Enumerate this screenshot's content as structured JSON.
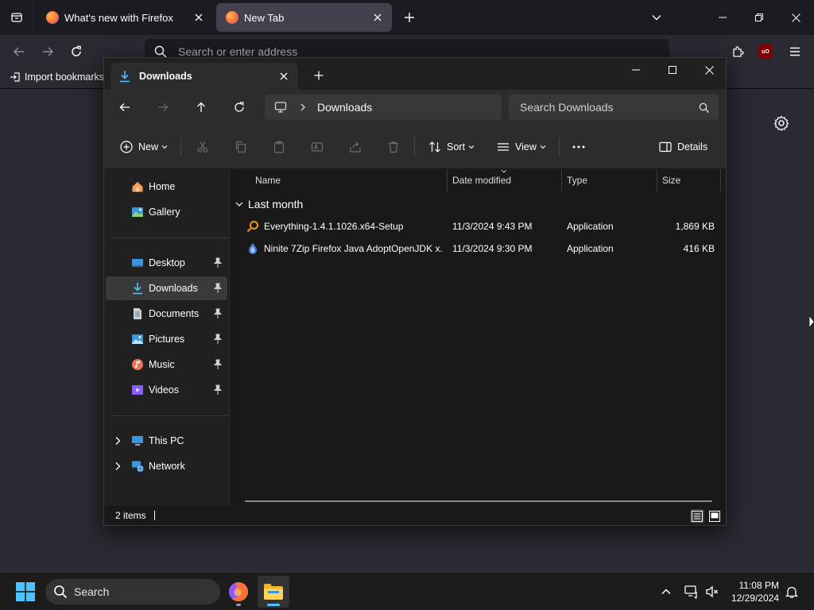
{
  "firefox": {
    "tabs": [
      {
        "title": "What's new with Firefox",
        "active": false
      },
      {
        "title": "New Tab",
        "active": true
      }
    ],
    "urlbar_placeholder": "Search or enter address",
    "bookmarks": {
      "import_label": "Import bookmarks..."
    },
    "extension_badge": "uO"
  },
  "explorer": {
    "tab_title": "Downloads",
    "breadcrumb": [
      "Downloads"
    ],
    "search_placeholder": "Search Downloads",
    "commands": {
      "new": "New",
      "sort": "Sort",
      "view": "View",
      "details": "Details"
    },
    "sidebar": {
      "top": [
        {
          "label": "Home",
          "icon": "home-icon"
        },
        {
          "label": "Gallery",
          "icon": "gallery-icon"
        }
      ],
      "pinned": [
        {
          "label": "Desktop",
          "icon": "desktop-icon"
        },
        {
          "label": "Downloads",
          "icon": "download-icon",
          "selected": true
        },
        {
          "label": "Documents",
          "icon": "documents-icon"
        },
        {
          "label": "Pictures",
          "icon": "pictures-icon"
        },
        {
          "label": "Music",
          "icon": "music-icon"
        },
        {
          "label": "Videos",
          "icon": "videos-icon"
        }
      ],
      "bottom": [
        {
          "label": "This PC",
          "icon": "computer-icon"
        },
        {
          "label": "Network",
          "icon": "network-icon"
        }
      ]
    },
    "columns": [
      "Name",
      "Date modified",
      "Type",
      "Size"
    ],
    "group": "Last month",
    "files": [
      {
        "name": "Everything-1.4.1.1026.x64-Setup",
        "date": "11/3/2024 9:43 PM",
        "type": "Application",
        "size": "1,869 KB",
        "icon": "everything-icon"
      },
      {
        "name": "Ninite 7Zip Firefox Java AdoptOpenJDK x...",
        "date": "11/3/2024 9:30 PM",
        "type": "Application",
        "size": "416 KB",
        "icon": "ninite-icon"
      }
    ],
    "status": "2 items"
  },
  "taskbar": {
    "search_placeholder": "Search",
    "time": "11:08 PM",
    "date": "12/29/2024"
  },
  "colors": {
    "firefox_bg": "#2b2a33",
    "explorer_bg": "#191919",
    "accent": "#4cc2ff"
  }
}
